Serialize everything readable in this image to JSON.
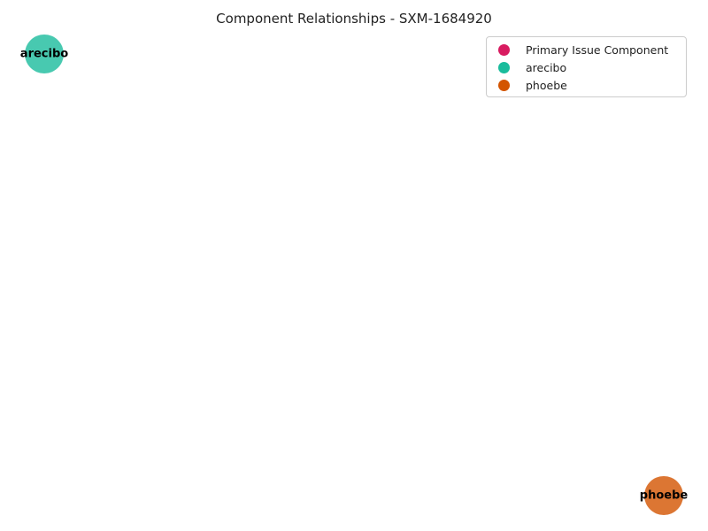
{
  "title": "Component Relationships - SXM-1684920",
  "colors": {
    "primary": "#d81b60",
    "arecibo": "#1abc9c",
    "phoebe": "#d35400"
  },
  "nodes": [
    {
      "label": "arecibo",
      "color": "#1abc9c"
    },
    {
      "label": "phoebe",
      "color": "#d35400"
    }
  ],
  "legend": [
    {
      "label": "Primary Issue Component",
      "color": "#d81b60"
    },
    {
      "label": "arecibo",
      "color": "#1abc9c"
    },
    {
      "label": "phoebe",
      "color": "#d35400"
    }
  ]
}
